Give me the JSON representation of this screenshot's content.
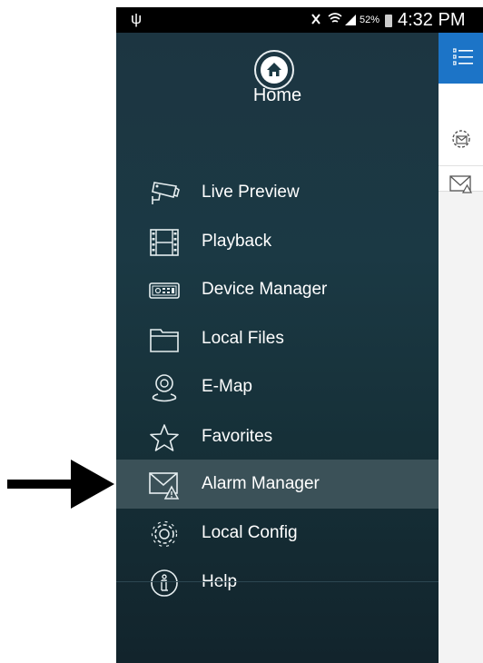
{
  "status_bar": {
    "battery": "52%",
    "time": "4:32 PM"
  },
  "drawer": {
    "home_label": "Home",
    "items": [
      {
        "label": "Live Preview",
        "icon": "camera-icon",
        "active": false
      },
      {
        "label": "Playback",
        "icon": "film-icon",
        "active": false
      },
      {
        "label": "Device Manager",
        "icon": "dvr-icon",
        "active": false
      },
      {
        "label": "Local Files",
        "icon": "folder-icon",
        "active": false
      },
      {
        "label": "E-Map",
        "icon": "map-pin-icon",
        "active": false
      },
      {
        "label": "Favorites",
        "icon": "star-icon",
        "active": false
      },
      {
        "label": "Alarm Manager",
        "icon": "alarm-mail-icon",
        "active": true
      },
      {
        "label": "Local Config",
        "icon": "gear-icon",
        "active": false
      },
      {
        "label": "Help",
        "icon": "help-icon",
        "active": false
      }
    ]
  },
  "colors": {
    "drawer_bg": "#1b3944",
    "active_item": "#3b5158",
    "app_bar": "#1c74c7"
  }
}
